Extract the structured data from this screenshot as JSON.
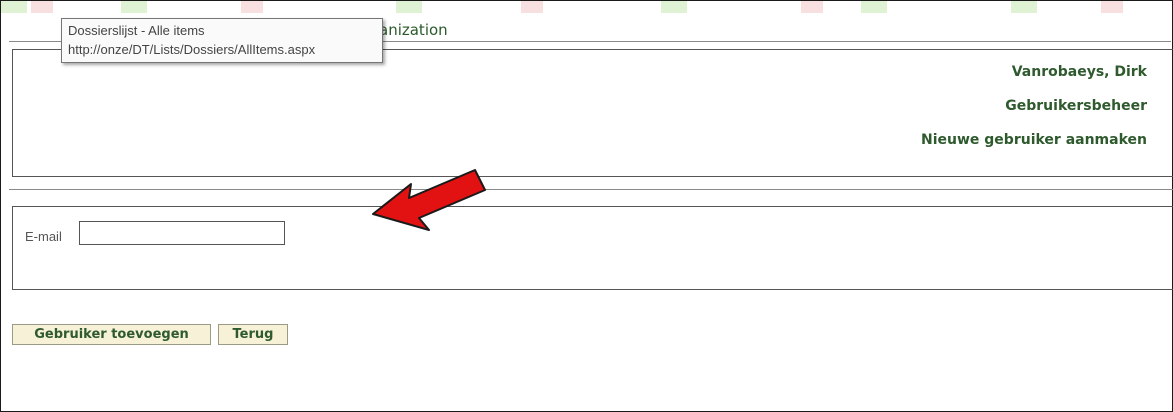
{
  "header": {
    "title_partial": "anization",
    "user_name": "Vanrobaeys, Dirk",
    "section": "Gebruikersbeheer",
    "subsection": "Nieuwe gebruiker aanmaken"
  },
  "tooltip": {
    "title": "Dossierslijst - Alle items",
    "url": "http://onze/DT/Lists/Dossiers/AllItems.aspx"
  },
  "form": {
    "email_label": "E-mail",
    "email_value": ""
  },
  "buttons": {
    "add_user": "Gebruiker toevoegen",
    "back": "Terug"
  },
  "colors": {
    "accent_text": "#2e5a2e",
    "button_bg": "#f7f1d8",
    "annotation_arrow": "#e31212"
  },
  "annotation": {
    "icon": "red-arrow-icon"
  }
}
